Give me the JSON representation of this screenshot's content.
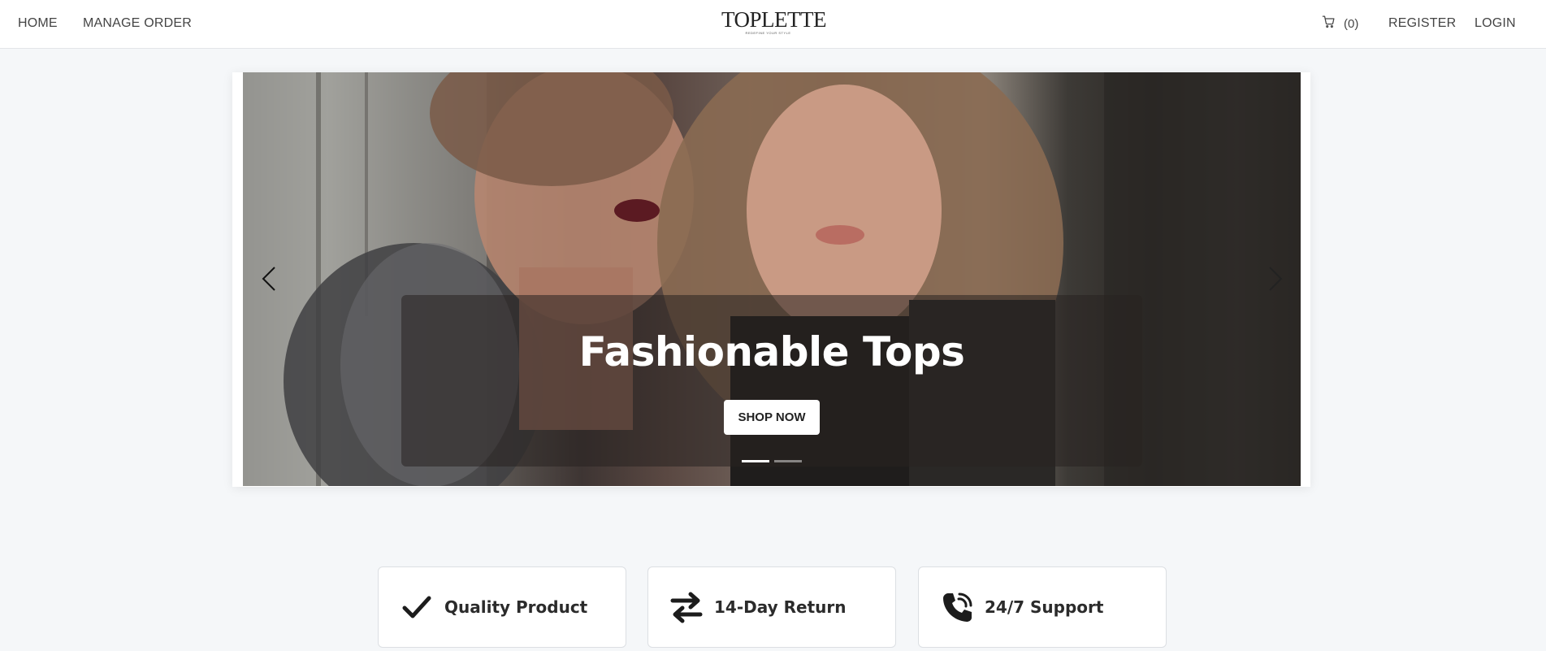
{
  "nav": {
    "home": "HOME",
    "manage_order": "MANAGE ORDER",
    "register": "REGISTER",
    "login": "LOGIN"
  },
  "logo": {
    "wordmark": "TOPLETTE",
    "tagline": "REDEFINE YOUR STYLE"
  },
  "cart": {
    "icon": "cart-icon",
    "count": "(0)"
  },
  "hero": {
    "title": "Fashionable Tops",
    "cta_label": "SHOP NOW",
    "prev_icon": "chevron-left-icon",
    "next_icon": "chevron-right-icon",
    "slide_count": 2,
    "active_slide": 1
  },
  "features": [
    {
      "icon": "checkmark-icon",
      "label": "Quality Product"
    },
    {
      "icon": "exchange-arrows-icon",
      "label": "14-Day Return"
    },
    {
      "icon": "phone-call-icon",
      "label": "24/7 Support"
    }
  ],
  "colors": {
    "page_background": "#f5f7f9",
    "header_background": "#ffffff",
    "text": "#333333",
    "button_background": "#ffffff"
  }
}
